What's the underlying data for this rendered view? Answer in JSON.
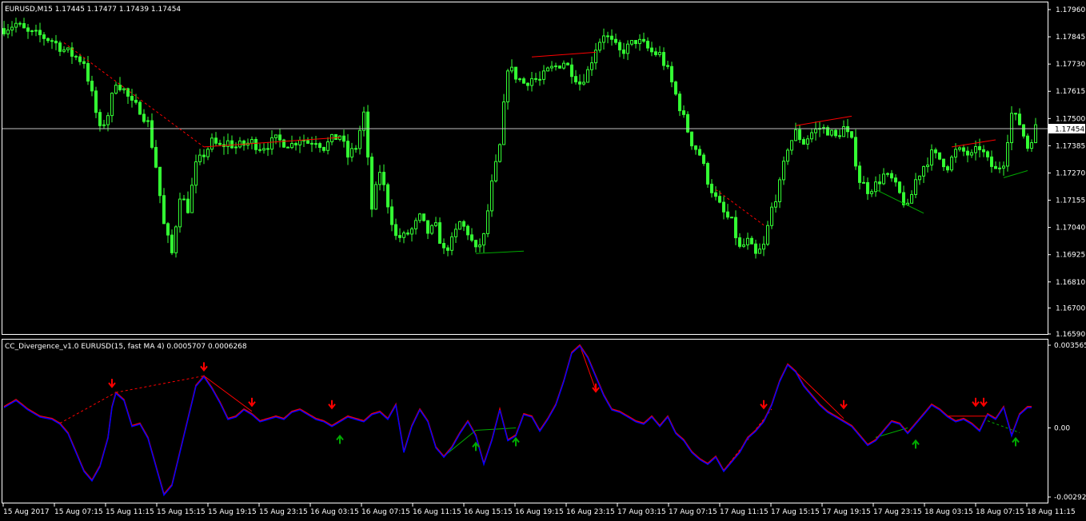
{
  "window": {
    "symbol_title": "EURUSD,M15  1.17445 1.17477 1.17439 1.17454"
  },
  "indicator": {
    "title": "CC_Divergence_v1.0 EURUSD(15, fast MA 4) 0.0005707 0.0006268"
  },
  "colors": {
    "background": "#000000",
    "frame": "#ffffff",
    "candles": "#33ff33",
    "bid_line": "#c0c0c0",
    "divergence_bear": "#ff0000",
    "divergence_bull": "#00aa00",
    "osc_fast": "#ff0000",
    "osc_slow": "#0000ff",
    "arrow_down": "#ff0000",
    "arrow_up": "#00aa00"
  },
  "chart_data": [
    {
      "type": "candlestick",
      "symbol": "EURUSD",
      "timeframe": "M15",
      "last_price": "1.17454",
      "price_axis_labels": [
        "1.17960",
        "1.17845",
        "1.17730",
        "1.17615",
        "1.17500",
        "1.17385",
        "1.17270",
        "1.17155",
        "1.17040",
        "1.16925",
        "1.16810",
        "1.16700",
        "1.16590"
      ],
      "ylim": [
        1.1659,
        1.1796
      ],
      "close_path": [
        [
          0,
          1.1788
        ],
        [
          3,
          1.179
        ],
        [
          6,
          1.1786
        ],
        [
          9,
          1.1785
        ],
        [
          12,
          1.1783
        ],
        [
          15,
          1.1779
        ],
        [
          18,
          1.1776
        ],
        [
          20,
          1.1774
        ],
        [
          22,
          1.176
        ],
        [
          24,
          1.1745
        ],
        [
          26,
          1.1752
        ],
        [
          28,
          1.1766
        ],
        [
          30,
          1.1762
        ],
        [
          32,
          1.1756
        ],
        [
          34,
          1.1754
        ],
        [
          36,
          1.1748
        ],
        [
          38,
          1.173
        ],
        [
          40,
          1.1705
        ],
        [
          42,
          1.1693
        ],
        [
          44,
          1.1718
        ],
        [
          46,
          1.1712
        ],
        [
          48,
          1.173
        ],
        [
          50,
          1.1735
        ],
        [
          52,
          1.174
        ],
        [
          54,
          1.1738
        ],
        [
          56,
          1.174
        ],
        [
          58,
          1.1738
        ],
        [
          60,
          1.1739
        ],
        [
          62,
          1.174
        ],
        [
          64,
          1.1738
        ],
        [
          66,
          1.1739
        ],
        [
          68,
          1.1741
        ],
        [
          70,
          1.174
        ],
        [
          72,
          1.1739
        ],
        [
          74,
          1.1742
        ],
        [
          76,
          1.174
        ],
        [
          78,
          1.1741
        ],
        [
          80,
          1.1738
        ],
        [
          82,
          1.1741
        ],
        [
          84,
          1.1743
        ],
        [
          86,
          1.1734
        ],
        [
          88,
          1.1738
        ],
        [
          90,
          1.1752
        ],
        [
          92,
          1.1712
        ],
        [
          94,
          1.1728
        ],
        [
          96,
          1.1714
        ],
        [
          98,
          1.17
        ],
        [
          100,
          1.17
        ],
        [
          102,
          1.1703
        ],
        [
          104,
          1.1708
        ],
        [
          106,
          1.1702
        ],
        [
          108,
          1.1704
        ],
        [
          110,
          1.1694
        ],
        [
          112,
          1.1698
        ],
        [
          114,
          1.1706
        ],
        [
          116,
          1.1702
        ],
        [
          118,
          1.1694
        ],
        [
          120,
          1.17
        ],
        [
          122,
          1.1722
        ],
        [
          124,
          1.1738
        ],
        [
          126,
          1.1772
        ],
        [
          128,
          1.1768
        ],
        [
          130,
          1.1765
        ],
        [
          132,
          1.1767
        ],
        [
          134,
          1.1766
        ],
        [
          136,
          1.177
        ],
        [
          138,
          1.1772
        ],
        [
          140,
          1.1774
        ],
        [
          142,
          1.177
        ],
        [
          144,
          1.1765
        ],
        [
          146,
          1.177
        ],
        [
          148,
          1.178
        ],
        [
          150,
          1.1786
        ],
        [
          152,
          1.1782
        ],
        [
          154,
          1.1778
        ],
        [
          156,
          1.178
        ],
        [
          158,
          1.1783
        ],
        [
          160,
          1.1781
        ],
        [
          162,
          1.1778
        ],
        [
          164,
          1.1777
        ],
        [
          166,
          1.177
        ],
        [
          168,
          1.176
        ],
        [
          170,
          1.175
        ],
        [
          172,
          1.174
        ],
        [
          174,
          1.1735
        ],
        [
          176,
          1.1724
        ],
        [
          178,
          1.1716
        ],
        [
          180,
          1.171
        ],
        [
          182,
          1.1706
        ],
        [
          184,
          1.1695
        ],
        [
          186,
          1.1698
        ],
        [
          188,
          1.1692
        ],
        [
          190,
          1.1696
        ],
        [
          192,
          1.1712
        ],
        [
          194,
          1.1722
        ],
        [
          196,
          1.1738
        ],
        [
          198,
          1.1744
        ],
        [
          200,
          1.174
        ],
        [
          202,
          1.1744
        ],
        [
          204,
          1.1746
        ],
        [
          206,
          1.1745
        ],
        [
          208,
          1.1742
        ],
        [
          210,
          1.1746
        ],
        [
          212,
          1.174
        ],
        [
          214,
          1.1724
        ],
        [
          216,
          1.172
        ],
        [
          218,
          1.1722
        ],
        [
          220,
          1.1726
        ],
        [
          222,
          1.1724
        ],
        [
          224,
          1.1718
        ],
        [
          226,
          1.1712
        ],
        [
          228,
          1.1724
        ],
        [
          230,
          1.173
        ],
        [
          232,
          1.1735
        ],
        [
          234,
          1.1733
        ],
        [
          236,
          1.173
        ],
        [
          238,
          1.1736
        ],
        [
          240,
          1.1736
        ],
        [
          242,
          1.1734
        ],
        [
          244,
          1.1738
        ],
        [
          246,
          1.1732
        ],
        [
          248,
          1.1728
        ],
        [
          250,
          1.1732
        ],
        [
          252,
          1.1752
        ],
        [
          254,
          1.1748
        ],
        [
          256,
          1.1738
        ],
        [
          258,
          1.1746
        ],
        [
          259,
          1.1745
        ]
      ]
    },
    {
      "type": "line",
      "name": "CC_Divergence_v1.0",
      "price_axis_labels": [
        "0.003565",
        "0.00",
        "-0.002921"
      ],
      "ylim": [
        -0.002921,
        0.003565
      ],
      "series_path": [
        [
          0,
          0.0009
        ],
        [
          3,
          0.0012
        ],
        [
          6,
          0.0008
        ],
        [
          9,
          0.0005
        ],
        [
          12,
          0.0004
        ],
        [
          14,
          0.0002
        ],
        [
          16,
          -0.0002
        ],
        [
          18,
          -0.001
        ],
        [
          20,
          -0.0018
        ],
        [
          22,
          -0.0022
        ],
        [
          24,
          -0.0016
        ],
        [
          26,
          -0.0004
        ],
        [
          27,
          0.0009
        ],
        [
          28,
          0.0015
        ],
        [
          30,
          0.0012
        ],
        [
          32,
          0.0001
        ],
        [
          34,
          0.0002
        ],
        [
          36,
          -0.0004
        ],
        [
          38,
          -0.0016
        ],
        [
          40,
          -0.0028
        ],
        [
          42,
          -0.0024
        ],
        [
          44,
          -0.001
        ],
        [
          46,
          0.0004
        ],
        [
          48,
          0.0018
        ],
        [
          50,
          0.0022
        ],
        [
          52,
          0.0017
        ],
        [
          54,
          0.0011
        ],
        [
          56,
          0.0004
        ],
        [
          58,
          0.0005
        ],
        [
          60,
          0.0008
        ],
        [
          62,
          0.0006
        ],
        [
          64,
          0.0003
        ],
        [
          66,
          0.0004
        ],
        [
          68,
          0.0005
        ],
        [
          70,
          0.0004
        ],
        [
          72,
          0.0007
        ],
        [
          74,
          0.0008
        ],
        [
          76,
          0.0006
        ],
        [
          78,
          0.0004
        ],
        [
          80,
          0.0003
        ],
        [
          82,
          0.0001
        ],
        [
          84,
          0.0003
        ],
        [
          86,
          0.0005
        ],
        [
          88,
          0.0004
        ],
        [
          90,
          0.0003
        ],
        [
          92,
          0.0006
        ],
        [
          94,
          0.0007
        ],
        [
          96,
          0.0004
        ],
        [
          98,
          0.001
        ],
        [
          100,
          -0.001
        ],
        [
          102,
          0.0001
        ],
        [
          104,
          0.0008
        ],
        [
          106,
          0.0003
        ],
        [
          108,
          -0.0008
        ],
        [
          110,
          -0.0012
        ],
        [
          112,
          -0.0008
        ],
        [
          114,
          -0.0002
        ],
        [
          116,
          0.0003
        ],
        [
          118,
          -0.0003
        ],
        [
          120,
          -0.0015
        ],
        [
          122,
          -0.0005
        ],
        [
          124,
          0.0008
        ],
        [
          126,
          -0.0005
        ],
        [
          128,
          -0.0003
        ],
        [
          130,
          0.0006
        ],
        [
          132,
          0.0005
        ],
        [
          134,
          -0.0001
        ],
        [
          136,
          0.0004
        ],
        [
          138,
          0.001
        ],
        [
          140,
          0.002
        ],
        [
          142,
          0.0032
        ],
        [
          144,
          0.0035
        ],
        [
          146,
          0.003
        ],
        [
          148,
          0.0022
        ],
        [
          150,
          0.0014
        ],
        [
          152,
          0.0008
        ],
        [
          154,
          0.0007
        ],
        [
          156,
          0.0005
        ],
        [
          158,
          0.0003
        ],
        [
          160,
          0.0002
        ],
        [
          162,
          0.0005
        ],
        [
          164,
          0.0001
        ],
        [
          166,
          0.0005
        ],
        [
          168,
          -0.0002
        ],
        [
          170,
          -0.0005
        ],
        [
          172,
          -0.001
        ],
        [
          174,
          -0.0013
        ],
        [
          176,
          -0.0015
        ],
        [
          178,
          -0.0012
        ],
        [
          180,
          -0.0018
        ],
        [
          182,
          -0.0014
        ],
        [
          184,
          -0.001
        ],
        [
          186,
          -0.0004
        ],
        [
          188,
          -0.0001
        ],
        [
          190,
          0.0003
        ],
        [
          192,
          0.001
        ],
        [
          194,
          0.002
        ],
        [
          196,
          0.0027
        ],
        [
          198,
          0.0024
        ],
        [
          200,
          0.0018
        ],
        [
          202,
          0.0014
        ],
        [
          204,
          0.001
        ],
        [
          206,
          0.0007
        ],
        [
          208,
          0.0005
        ],
        [
          210,
          0.0003
        ],
        [
          212,
          0.0001
        ],
        [
          214,
          -0.0003
        ],
        [
          216,
          -0.0007
        ],
        [
          218,
          -0.0005
        ],
        [
          220,
          -0.0001
        ],
        [
          222,
          0.0003
        ],
        [
          224,
          0.0002
        ],
        [
          226,
          -0.0002
        ],
        [
          228,
          0.0002
        ],
        [
          230,
          0.0006
        ],
        [
          232,
          0.001
        ],
        [
          234,
          0.0008
        ],
        [
          236,
          0.0005
        ],
        [
          238,
          0.0003
        ],
        [
          240,
          0.0004
        ],
        [
          242,
          0.0002
        ],
        [
          244,
          -0.0001
        ],
        [
          246,
          0.0006
        ],
        [
          248,
          0.0004
        ],
        [
          250,
          0.0009
        ],
        [
          252,
          -0.0003
        ],
        [
          254,
          0.0006
        ],
        [
          256,
          0.0009
        ],
        [
          257,
          0.0009
        ]
      ]
    }
  ],
  "time_axis": {
    "labels": [
      "15 Aug 2017",
      "15 Aug 07:15",
      "15 Aug 11:15",
      "15 Aug 15:15",
      "15 Aug 19:15",
      "15 Aug 23:15",
      "16 Aug 03:15",
      "16 Aug 07:15",
      "16 Aug 11:15",
      "16 Aug 15:15",
      "16 Aug 19:15",
      "16 Aug 23:15",
      "17 Aug 03:15",
      "17 Aug 07:15",
      "17 Aug 11:15",
      "17 Aug 15:15",
      "17 Aug 19:15",
      "17 Aug 23:15",
      "18 Aug 03:15",
      "18 Aug 07:15",
      "18 Aug 11:15"
    ]
  }
}
